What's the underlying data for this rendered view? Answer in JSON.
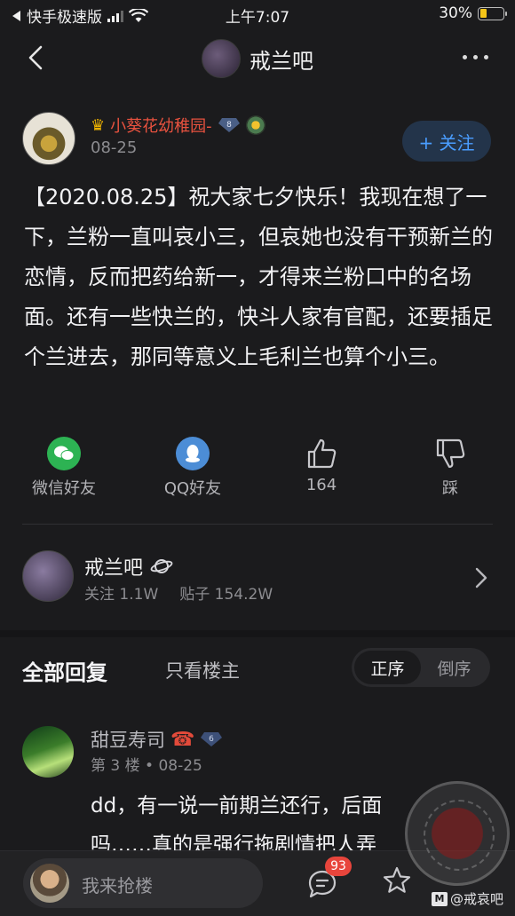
{
  "status_bar": {
    "carrier": "快手极速版",
    "time": "上午7:07",
    "battery_percent": "30%",
    "battery_level": 0.3,
    "icons": [
      "back-triangle-icon",
      "signal-icon",
      "wifi-icon",
      "battery-icon"
    ]
  },
  "nav": {
    "title": "戒兰吧",
    "icons": [
      "back-chevron-icon",
      "forum-avatar",
      "more-dots-icon"
    ]
  },
  "post": {
    "author": "小葵花幼稚园-",
    "level_badge": "8",
    "date": "08-25",
    "follow_label": "+ 关注",
    "content": "【2020.08.25】祝大家七夕快乐！我现在想了一下，兰粉一直叫哀小三，但哀她也没有干预新兰的恋情，反而把药给新一，才得来兰粉口中的名场面。还有一些快兰的，快斗人家有官配，还要插足个兰进去，那同等意义上毛利兰也算个小三。",
    "actions": {
      "wechat_label": "微信好友",
      "qq_label": "QQ好友",
      "like_count": "164",
      "dislike_label": "踩"
    }
  },
  "forum": {
    "name": "戒兰吧",
    "followers": "关注 1.1W",
    "posts": "贴子 154.2W"
  },
  "replies_header": {
    "all_label": "全部回复",
    "owner_only_label": "只看楼主",
    "sort_asc": "正序",
    "sort_desc": "倒序",
    "active_sort": "正序"
  },
  "reply": {
    "name": "甜豆寿司",
    "phone_icon": "☎",
    "level_badge": "6",
    "meta": "第 3 楼 • 08-25",
    "text_line1": "dd，有一说一前期兰还行，后面",
    "text_line2": "吗……真的是强行拖剧情把人弄"
  },
  "bottom_bar": {
    "placeholder": "我来抢楼",
    "comment_count": "93"
  },
  "watermark": {
    "text": "@戒哀吧",
    "logo_letter": "M"
  },
  "colors": {
    "background": "#1b1b1d",
    "accent_blue": "#4a9dff",
    "author_red": "#e8523f",
    "badge_red": "#e8453c"
  }
}
